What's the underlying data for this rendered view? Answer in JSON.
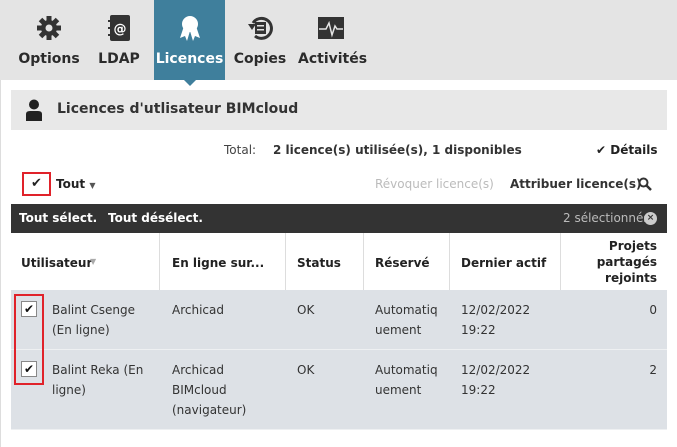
{
  "nav": {
    "tabs": [
      {
        "label": "Options",
        "icon": "gear-icon"
      },
      {
        "label": "LDAP",
        "icon": "address-book-icon"
      },
      {
        "label": "Licences",
        "icon": "ribbon-icon"
      },
      {
        "label": "Copies",
        "icon": "backup-icon"
      },
      {
        "label": "Activités",
        "icon": "activity-icon"
      }
    ],
    "active": "Licences"
  },
  "header": {
    "title": "Licences d'utlisateur BIMcloud",
    "icon": "user-icon"
  },
  "summary": {
    "label": "Total:",
    "value": "2 licence(s) utilisée(s), 1 disponibles",
    "details": "Détails"
  },
  "toolbar": {
    "select_label": "Tout",
    "revoke": "Révoquer licence(s)",
    "assign": "Attribuer licence(s)"
  },
  "selection_bar": {
    "select_all": "Tout sélect.",
    "deselect_all": "Tout désélect.",
    "count": "2 sélectionnés"
  },
  "table": {
    "columns": [
      "Utilisateur",
      "En ligne sur...",
      "Status",
      "Réservé",
      "Dernier actif",
      "Projets partagés rejoints"
    ],
    "rows": [
      {
        "checked": true,
        "user": "Balint Csenge (En ligne)",
        "online": "Archicad",
        "status": "OK",
        "reserved": "Automatiquement",
        "last": "12/02/2022 19:22",
        "projects": "0"
      },
      {
        "checked": true,
        "user": "Balint Reka (En ligne)",
        "online": "Archicad BIMcloud (navigateur)",
        "status": "OK",
        "reserved": "Automatiquement",
        "last": "12/02/2022 19:22",
        "projects": "2"
      }
    ]
  },
  "colors": {
    "accent": "#3f7f9c",
    "highlight": "#e0222a",
    "dark_bar": "#333333",
    "row_bg": "#dde1e6"
  }
}
